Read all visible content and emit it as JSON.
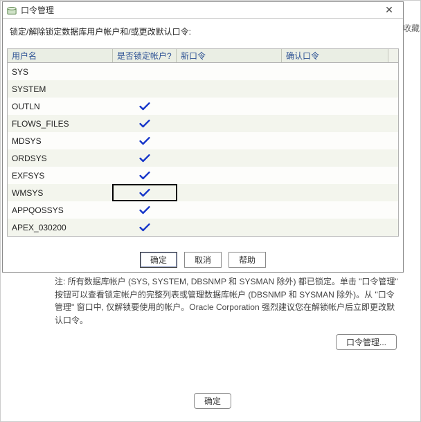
{
  "dialog": {
    "title": "口令管理",
    "instruction": "锁定/解除锁定数据库用户帐户和/或更改默认口令:",
    "columns": {
      "user": "用户名",
      "lock": "是否锁定帐户?",
      "newpwd": "新口令",
      "confirm": "确认口令"
    },
    "rows": [
      {
        "user": "SYS",
        "locked": false,
        "selected": false
      },
      {
        "user": "SYSTEM",
        "locked": false,
        "selected": false
      },
      {
        "user": "OUTLN",
        "locked": true,
        "selected": false
      },
      {
        "user": "FLOWS_FILES",
        "locked": true,
        "selected": false
      },
      {
        "user": "MDSYS",
        "locked": true,
        "selected": false
      },
      {
        "user": "ORDSYS",
        "locked": true,
        "selected": false
      },
      {
        "user": "EXFSYS",
        "locked": true,
        "selected": false
      },
      {
        "user": "WMSYS",
        "locked": true,
        "selected": true
      },
      {
        "user": "APPQOSSYS",
        "locked": true,
        "selected": false
      },
      {
        "user": "APEX_030200",
        "locked": true,
        "selected": false
      }
    ],
    "buttons": {
      "ok": "确定",
      "cancel": "取消",
      "help": "帮助"
    }
  },
  "background": {
    "note": "注: 所有数据库帐户 (SYS, SYSTEM, DBSNMP 和 SYSMAN 除外) 都已锁定。单击 \"口令管理\" 按钮可以查看锁定帐户的完整列表或管理数据库帐户 (DBSNMP 和 SYSMAN 除外)。从 \"口令管理\" 窗口中, 仅解锁要使用的帐户。Oracle Corporation 强烈建议您在解锁帐户后立即更改默认口令。",
    "manage_btn": "口令管理...",
    "ok_btn": "确定",
    "right_tab": "收藏"
  }
}
